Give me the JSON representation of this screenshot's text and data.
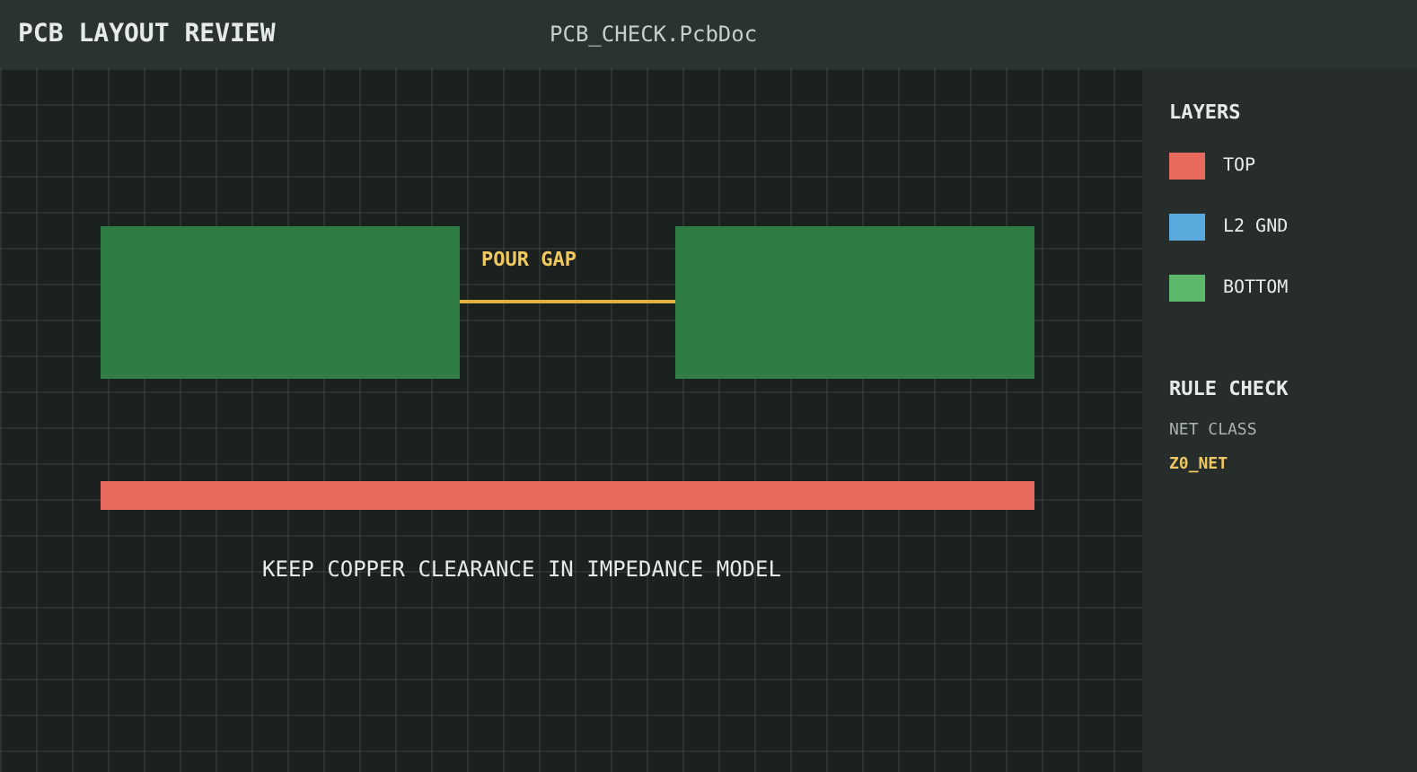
{
  "header": {
    "title": "PCB LAYOUT REVIEW",
    "file_name": "PCB_CHECK.PcbDoc"
  },
  "canvas": {
    "gap_label": "POUR GAP",
    "note": "KEEP COPPER CLEARANCE IN IMPEDANCE MODEL"
  },
  "layers": {
    "title": "LAYERS",
    "items": [
      {
        "name": "TOP",
        "color": "#e8695e"
      },
      {
        "name": "L2 GND",
        "color": "#5aa9dc"
      },
      {
        "name": "BOTTOM",
        "color": "#5cb86a"
      }
    ]
  },
  "rule_check": {
    "title": "RULE CHECK",
    "label": "NET CLASS",
    "value": "Z0_NET"
  }
}
